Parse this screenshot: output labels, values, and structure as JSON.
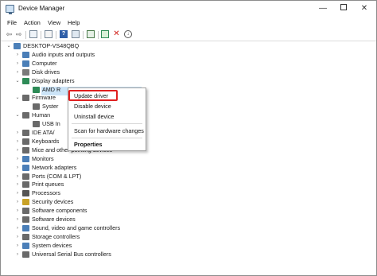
{
  "window": {
    "title": "Device Manager"
  },
  "menu": [
    "File",
    "Action",
    "View",
    "Help"
  ],
  "toolbar": {
    "buttons": [
      "back-arrow",
      "forward-arrow",
      "properties-sheet",
      "refresh-list",
      "help",
      "list-view",
      "scan-computer",
      "add-driver",
      "uninstall-x",
      "download-update"
    ]
  },
  "tree": {
    "root": "DESKTOP-VS48QBQ",
    "categories": [
      {
        "label": "Audio inputs and outputs",
        "icon": "speaker-icon",
        "color": "#4b7fb8",
        "expanded": false
      },
      {
        "label": "Computer",
        "icon": "monitor-icon",
        "color": "#4b7fb8",
        "expanded": false
      },
      {
        "label": "Disk drives",
        "icon": "drive-icon",
        "color": "#7a7a7a",
        "expanded": false
      },
      {
        "label": "Display adapters",
        "icon": "display-adapter-icon",
        "color": "#2e8b57",
        "expanded": true
      },
      {
        "label": "Firmware",
        "icon": "chip-icon",
        "color": "#6a6a6a",
        "expanded": true
      },
      {
        "label": "Human",
        "icon": "keyboard-icon",
        "color": "#6a6a6a",
        "expanded": true
      },
      {
        "label": "IDE ATA/",
        "icon": "disk-controller-icon",
        "color": "#6a6a6a",
        "expanded": false
      },
      {
        "label": "Keyboards",
        "icon": "keyboard-icon",
        "color": "#6a6a6a",
        "expanded": false
      },
      {
        "label": "Mice and other pointing devices",
        "icon": "mouse-icon",
        "color": "#6a6a6a",
        "expanded": false
      },
      {
        "label": "Monitors",
        "icon": "monitor-icon",
        "color": "#4b7fb8",
        "expanded": false
      },
      {
        "label": "Network adapters",
        "icon": "network-icon",
        "color": "#4b7fb8",
        "expanded": false
      },
      {
        "label": "Ports (COM & LPT)",
        "icon": "port-icon",
        "color": "#6a6a6a",
        "expanded": false
      },
      {
        "label": "Print queues",
        "icon": "printer-icon",
        "color": "#6a6a6a",
        "expanded": false
      },
      {
        "label": "Processors",
        "icon": "cpu-icon",
        "color": "#555555",
        "expanded": false
      },
      {
        "label": "Security devices",
        "icon": "security-icon",
        "color": "#c9a227",
        "expanded": false
      },
      {
        "label": "Software components",
        "icon": "component-icon",
        "color": "#6a6a6a",
        "expanded": false
      },
      {
        "label": "Software devices",
        "icon": "component-icon",
        "color": "#6a6a6a",
        "expanded": false
      },
      {
        "label": "Sound, video and game controllers",
        "icon": "speaker-icon",
        "color": "#4b7fb8",
        "expanded": false
      },
      {
        "label": "Storage controllers",
        "icon": "storage-icon",
        "color": "#6a6a6a",
        "expanded": false
      },
      {
        "label": "System devices",
        "icon": "system-icon",
        "color": "#4b7fb8",
        "expanded": false
      },
      {
        "label": "Universal Serial Bus controllers",
        "icon": "usb-icon",
        "color": "#6a6a6a",
        "expanded": false
      }
    ],
    "children": {
      "display": "AMD R",
      "firmware": "Syster",
      "human": "USB In"
    }
  },
  "context_menu": {
    "items": [
      "Update driver",
      "Disable device",
      "Uninstall device",
      "Scan for hardware changes",
      "Properties"
    ],
    "highlight_color": "#e02020"
  }
}
